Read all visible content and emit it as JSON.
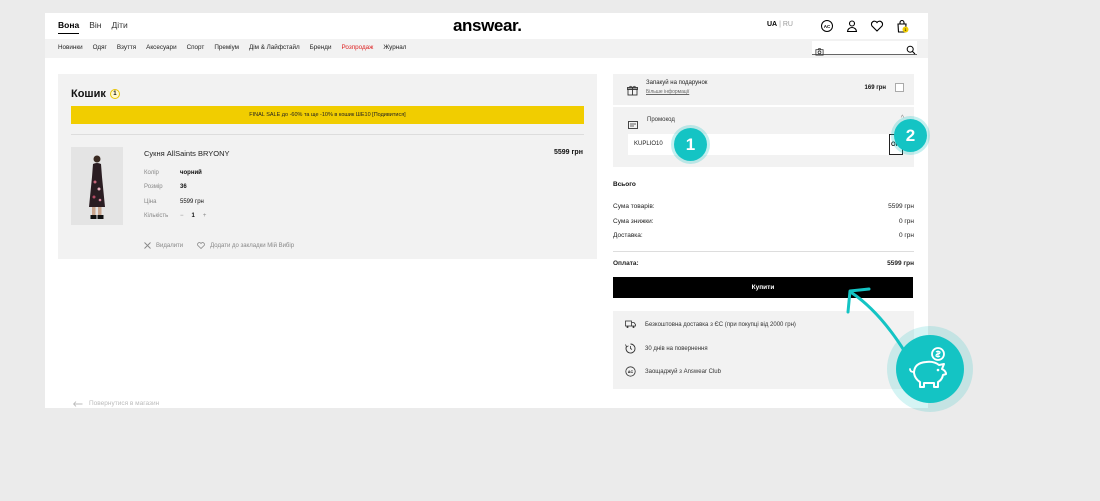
{
  "header": {
    "gender_tabs": [
      "Вона",
      "Він",
      "Діти"
    ],
    "logo": "answear.",
    "lang_active": "UA",
    "lang_sep": "|",
    "lang_other": "RU",
    "cart_count": "1"
  },
  "nav": {
    "items": [
      "Новинки",
      "Одяг",
      "Взуття",
      "Аксесуари",
      "Спорт",
      "Преміум",
      "Дім & Лайфстайл",
      "Бренди",
      "Розпродаж",
      "Журнал"
    ]
  },
  "cart": {
    "title": "Кошик",
    "count": "1",
    "promo_banner": "FINAL SALE до -60% та ще -10% в кошик ШЕ10 [Подивитися]",
    "product": {
      "name": "Сукня AllSaints BRYONY",
      "price": "5599 грн",
      "color_label": "Колір",
      "color_value": "чорний",
      "size_label": "Розмір",
      "size_value": "36",
      "price_label": "Ціна",
      "price_value": "5599 грн",
      "qty_label": "Кількість",
      "qty_minus": "−",
      "qty_value": "1",
      "qty_plus": "+"
    },
    "remove_label": "Видалити",
    "wishlist_label": "Додати до закладки Мій Вибір"
  },
  "back_label": "Повернутися в магазин",
  "gift": {
    "title": "Запакуй на подарунок",
    "link": "Більше інформації",
    "price": "169 грн"
  },
  "promo": {
    "label": "Промокод",
    "code": "KUPLIO10",
    "apply": "Ок"
  },
  "summary": {
    "heading": "Всього",
    "goods_label": "Сума товарів:",
    "goods_value": "5599 грн",
    "discount_label": "Сума знижки:",
    "discount_value": "0 грн",
    "delivery_label": "Доставка:",
    "delivery_value": "0 грн",
    "total_label": "Оплата:",
    "total_value": "5599 грн"
  },
  "buy_label": "Купити",
  "benefits": [
    "Безкоштовна доставка з ЄС (при покупці від 2000 грн)",
    "30 днів на повернення",
    "Заощаджуй з Answear Club"
  ],
  "steps": [
    "1",
    "2"
  ],
  "colors": {
    "accent": "#14c4c4",
    "promo_yellow": "#f1cd00",
    "sale_red": "#d22222"
  }
}
